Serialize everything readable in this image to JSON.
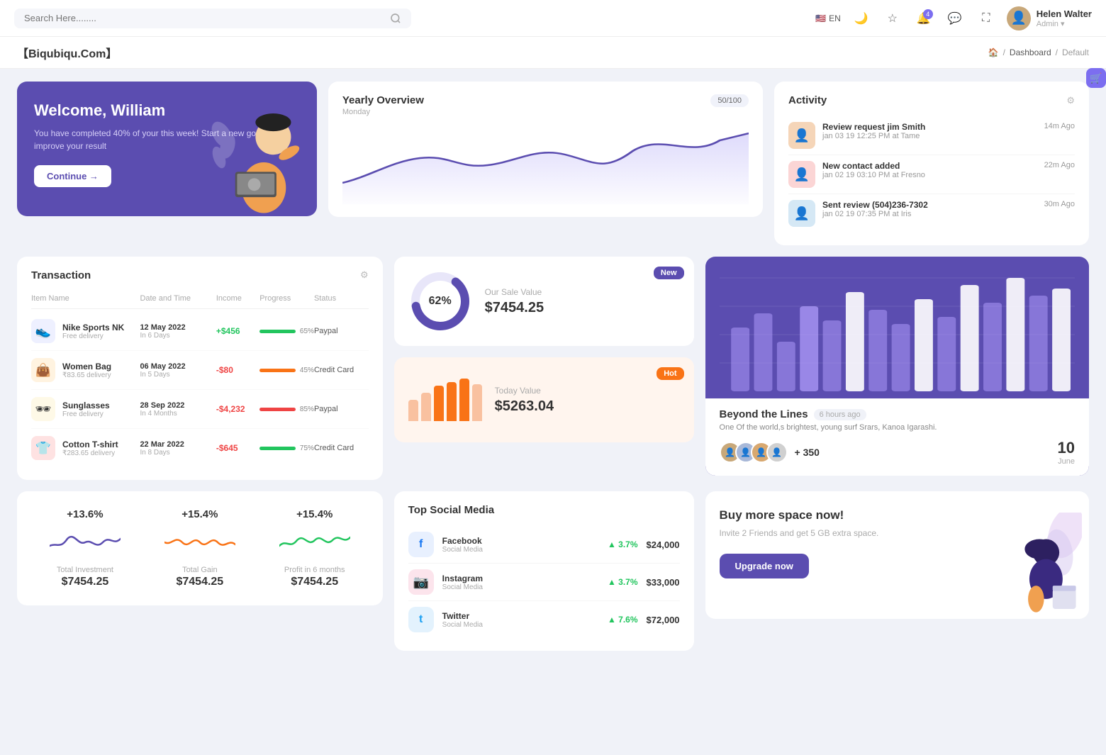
{
  "topnav": {
    "search_placeholder": "Search Here........",
    "lang": "EN",
    "user": {
      "name": "Helen Walter",
      "role": "Admin"
    },
    "bell_badge": "4"
  },
  "breadcrumb": {
    "brand": "【Biqubiqu.Com】",
    "items": [
      "Home",
      "Dashboard",
      "Default"
    ]
  },
  "welcome": {
    "title": "Welcome, William",
    "subtitle": "You have completed 40% of your this week! Start a new goal & improve your result",
    "cta": "Continue →"
  },
  "yearly_overview": {
    "title": "Yearly Overview",
    "subtitle": "Monday",
    "badge": "50/100"
  },
  "activity": {
    "title": "Activity",
    "items": [
      {
        "title": "Review request jim Smith",
        "desc": "jan 03 19 12:25 PM at Tame",
        "time": "14m Ago"
      },
      {
        "title": "New contact added",
        "desc": "jan 02 19 03:10 PM at Fresno",
        "time": "22m Ago"
      },
      {
        "title": "Sent review (504)236-7302",
        "desc": "jan 02 19 07:35 PM at Iris",
        "time": "30m Ago"
      }
    ]
  },
  "transaction": {
    "title": "Transaction",
    "columns": [
      "Item Name",
      "Date and Time",
      "Income",
      "Progress",
      "Status"
    ],
    "rows": [
      {
        "icon": "👟",
        "icon_bg": "#eef0ff",
        "name": "Nike Sports NK",
        "sub": "Free delivery",
        "date": "12 May 2022",
        "date_sub": "In 6 Days",
        "income": "+$456",
        "income_type": "pos",
        "progress": 65,
        "progress_color": "#22c55e",
        "status": "Paypal"
      },
      {
        "icon": "👜",
        "icon_bg": "#fff3e0",
        "name": "Women Bag",
        "sub": "₹83.65 delivery",
        "date": "06 May 2022",
        "date_sub": "In 5 Days",
        "income": "-$80",
        "income_type": "neg",
        "progress": 45,
        "progress_color": "#f97316",
        "status": "Credit Card"
      },
      {
        "icon": "🕶",
        "icon_bg": "#fef9e7",
        "name": "Sunglasses",
        "sub": "Free delivery",
        "date": "28 Sep 2022",
        "date_sub": "In 4 Months",
        "income": "-$4,232",
        "income_type": "neg",
        "progress": 85,
        "progress_color": "#ef4444",
        "status": "Paypal"
      },
      {
        "icon": "👕",
        "icon_bg": "#fee2e2",
        "name": "Cotton T-shirt",
        "sub": "₹283.65 delivery",
        "date": "22 Mar 2022",
        "date_sub": "In 8 Days",
        "income": "-$645",
        "income_type": "neg",
        "progress": 75,
        "progress_color": "#22c55e",
        "status": "Credit Card"
      }
    ]
  },
  "sale_cards": {
    "new": {
      "badge": "New",
      "badge_color": "#5b4db0",
      "label": "Our Sale Value",
      "value": "$7454.25",
      "pct": "62%",
      "donut_color": "#5b4db0",
      "donut_bg": "#e8e6f9"
    },
    "hot": {
      "badge": "Hot",
      "badge_color": "#f97316",
      "label": "Today Value",
      "value": "$5263.04",
      "bars": [
        30,
        45,
        55,
        60,
        75,
        65
      ]
    }
  },
  "beyond": {
    "title": "Beyond the Lines",
    "time": "6 hours ago",
    "desc": "One Of the world,s brightest, young surf Srars, Kanoa Igarashi.",
    "count": "+ 350",
    "date_num": "10",
    "date_month": "June"
  },
  "sparklines": [
    {
      "pct": "+13.6%",
      "color": "#5b4db0",
      "label": "Total Investment",
      "value": "$7454.25"
    },
    {
      "pct": "+15.4%",
      "color": "#f97316",
      "label": "Total Gain",
      "value": "$7454.25"
    },
    {
      "pct": "+15.4%",
      "color": "#22c55e",
      "label": "Profit in 6 months",
      "value": "$7454.25"
    }
  ],
  "social_media": {
    "title": "Top Social Media",
    "items": [
      {
        "name": "Facebook",
        "type": "Social Media",
        "icon": "f",
        "icon_color": "#1877f2",
        "icon_bg": "#e8f0fe",
        "change": "3.7%",
        "amount": "$24,000"
      },
      {
        "name": "Instagram",
        "type": "Social Media",
        "icon": "📷",
        "icon_color": "#e1306c",
        "icon_bg": "#fce4ec",
        "change": "3.7%",
        "amount": "$33,000"
      },
      {
        "name": "Twitter",
        "type": "Social Media",
        "icon": "t",
        "icon_color": "#1da1f2",
        "icon_bg": "#e3f2fd",
        "change": "7.6%",
        "amount": "$72,000"
      }
    ]
  },
  "buy_space": {
    "title": "Buy more space now!",
    "desc": "Invite 2 Friends and get 5 GB extra space.",
    "cta": "Upgrade now"
  }
}
